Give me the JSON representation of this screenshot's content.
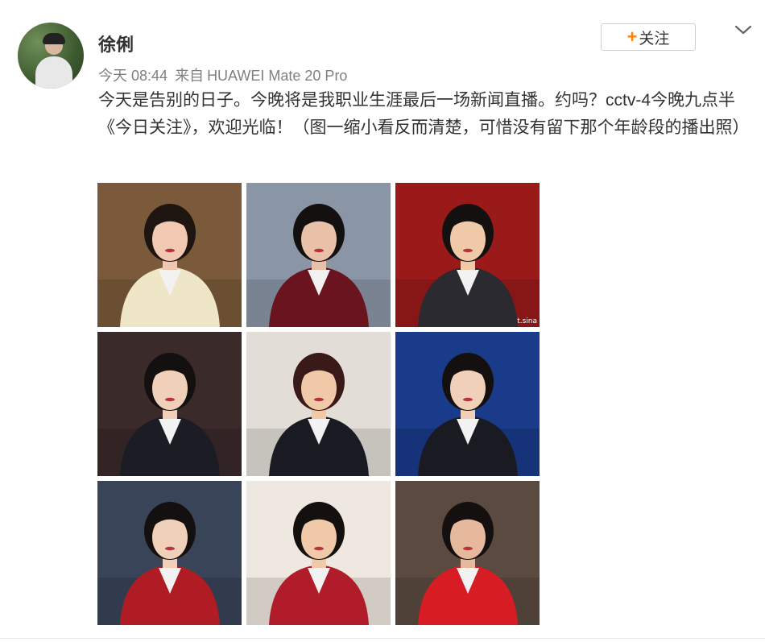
{
  "post": {
    "author": "徐俐",
    "time": "今天 08:44",
    "source_prefix": "来自",
    "device": "HUAWEI Mate 20 Pro",
    "text": "今天是告别的日子。今晚将是我职业生涯最后一场新闻直播。约吗？cctv-4今晚九点半《今日关注》，欢迎光临！（图一缩小看反而清楚，可惜没有留下那个年龄段的播出照）",
    "follow_label": "关注",
    "follow_icon": "plus-icon",
    "menu_icon": "chevron-down-icon",
    "photo_watermark": "t.sina",
    "accent_color": "#ff8200"
  },
  "photos": [
    {
      "bg": "#7a5a3a",
      "suit": "#efe6c8",
      "hair": "#1e1410",
      "face": "#f1c9b2"
    },
    {
      "bg": "#8a96a6",
      "suit": "#6a1420",
      "hair": "#141010",
      "face": "#e9c0a8"
    },
    {
      "bg": "#9a1a1a",
      "suit": "#2a2a30",
      "hair": "#141010",
      "face": "#f0caa8"
    },
    {
      "bg": "#3a2a2a",
      "suit": "#1c1c24",
      "hair": "#141010",
      "face": "#f0d0b8"
    },
    {
      "bg": "#e2ddd6",
      "suit": "#1a1a22",
      "hair": "#3a1a18",
      "face": "#f0caa8"
    },
    {
      "bg": "#1a3a8a",
      "suit": "#1a1a22",
      "hair": "#141010",
      "face": "#f0d0b8"
    },
    {
      "bg": "#3a4458",
      "suit": "#b01c24",
      "hair": "#141010",
      "face": "#f0d0b8"
    },
    {
      "bg": "#efe8e0",
      "suit": "#b01c2a",
      "hair": "#141010",
      "face": "#f0caa8"
    },
    {
      "bg": "#5a4a40",
      "suit": "#d81c24",
      "hair": "#141010",
      "face": "#e6b89c"
    }
  ]
}
